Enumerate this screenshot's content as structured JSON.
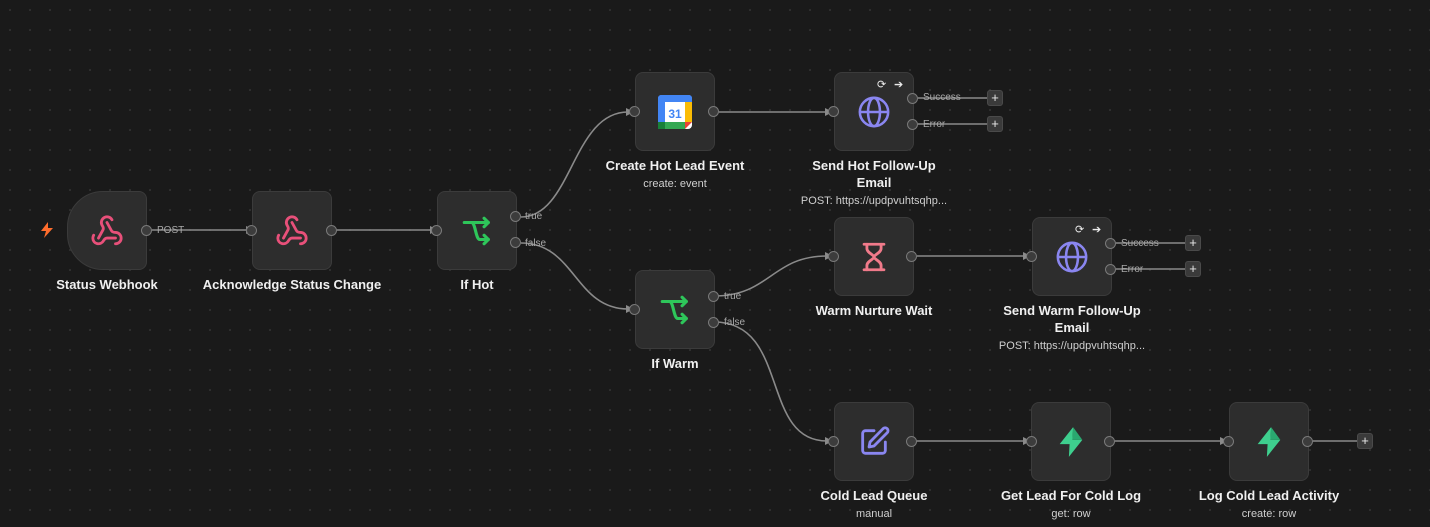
{
  "nodes": {
    "status_webhook": {
      "title": "Status Webhook",
      "icon": "webhook-icon"
    },
    "acknowledge": {
      "title": "Acknowledge Status Change",
      "icon": "webhook-icon"
    },
    "if_hot": {
      "title": "If Hot",
      "icon": "branch-icon"
    },
    "create_event": {
      "title": "Create Hot Lead Event",
      "subtitle": "create: event",
      "icon": "google-calendar-icon"
    },
    "send_hot": {
      "title": "Send Hot Follow-Up Email",
      "subtitle": "POST: https://updpvuhtsqhp...",
      "icon": "globe-icon"
    },
    "if_warm": {
      "title": "If Warm",
      "icon": "branch-icon"
    },
    "warm_wait": {
      "title": "Warm Nurture Wait",
      "icon": "hourglass-icon"
    },
    "send_warm": {
      "title": "Send Warm Follow-Up Email",
      "subtitle": "POST: https://updpvuhtsqhp...",
      "icon": "globe-icon"
    },
    "cold_queue": {
      "title": "Cold Lead Queue",
      "subtitle": "manual",
      "icon": "edit-icon"
    },
    "get_lead": {
      "title": "Get Lead For Cold Log",
      "subtitle": "get: row",
      "icon": "supabase-icon"
    },
    "log_cold": {
      "title": "Log Cold Lead Activity",
      "subtitle": "create: row",
      "icon": "supabase-icon"
    }
  },
  "edge_labels": {
    "post": "POST",
    "true": "true",
    "false": "false",
    "success": "Success",
    "error": "Error"
  },
  "calendar_day": "31",
  "plus_symbol": "+",
  "badge_icons": [
    "retry-icon",
    "arrow-right-icon"
  ],
  "colors": {
    "background": "#1a1a1a",
    "node": "#2d2d2d",
    "webhook": "#e8507a",
    "branch": "#2ec65a",
    "globe": "#8a86f0",
    "hourglass": "#f07a8a",
    "edit": "#8a86f0",
    "supabase": "#3ecf8e",
    "trigger_bolt": "#ff6d2d"
  }
}
